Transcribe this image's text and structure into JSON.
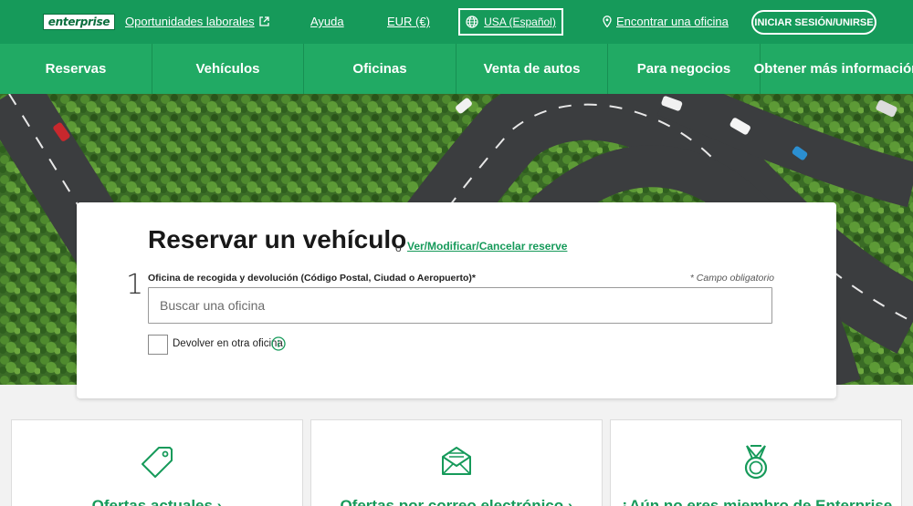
{
  "topbar": {
    "logo": "enterprise",
    "careers_label": "Oportunidades laborales",
    "help_label": "Ayuda",
    "currency_label": "EUR (€)",
    "locale_label": "USA (Español)",
    "find_office_label": "Encontrar una oficina",
    "signin_label": "INICIAR SESIÓN/UNIRSE"
  },
  "nav": {
    "items": [
      {
        "label": "Reservas"
      },
      {
        "label": "Vehículos"
      },
      {
        "label": "Oficinas"
      },
      {
        "label": "Venta de autos"
      },
      {
        "label": "Para negocios"
      },
      {
        "label": "Obtener más información"
      }
    ]
  },
  "booking": {
    "title": "Reservar un vehículo",
    "or_text": "o",
    "modify_link": "Ver/Modificar/Cancelar reserve",
    "step_number": "1",
    "field_label": "Oficina de recogida y devolución (Código Postal, Ciudad o Aeropuerto)*",
    "required_note": "* Campo obligatorio",
    "search_placeholder": "Buscar una oficina",
    "search_value": "",
    "return_checked": false,
    "return_label": "Devolver en otra oficina"
  },
  "features": [
    {
      "title": "Ofertas actuales ›",
      "icon": "tag-icon"
    },
    {
      "title": "Ofertas por correo electrónico ›",
      "icon": "envelope-icon"
    },
    {
      "title": "¿Aún no eres miembro de Enterprise",
      "icon": "medal-icon"
    }
  ],
  "colors": {
    "topbar": "#169a5a",
    "nav": "#21aa64",
    "link": "#169a5a"
  }
}
